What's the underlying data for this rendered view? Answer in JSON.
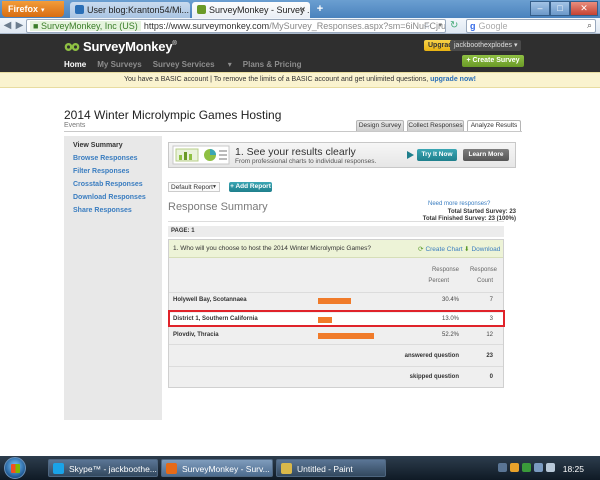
{
  "browser": {
    "menu_label": "Firefox",
    "tabs": [
      {
        "title": "User blog:Kranton54/Mi...",
        "active": false
      },
      {
        "title": "SurveyMonkey - Survey ...",
        "active": true
      }
    ],
    "identity": "SurveyMonkey, Inc (US)",
    "url_host": "https://www.surveymonkey.com",
    "url_rest": "/MySurvey_Responses.aspx?sm=6iNuFCjru",
    "search_engine": "Google",
    "search_placeholder": "Google"
  },
  "sm_header": {
    "logo_text": "SurveyMonkey",
    "upgrade_label": "Upgrade",
    "username": "jackboothexplodes",
    "nav": [
      "Home",
      "My Surveys",
      "Survey Services",
      "Plans & Pricing"
    ],
    "nav_active": "Home",
    "nav_dropdown": "Survey Services",
    "create_survey_label": "+ Create Survey"
  },
  "basic_banner": {
    "text": "You have a BASIC account   |   To remove the limits of a BASIC account and get unlimited questions,",
    "link": "upgrade now!"
  },
  "page": {
    "title": "2014 Winter Microlympic Games Hosting",
    "subtitle": "Events",
    "tabs": [
      "Design Survey",
      "Collect Responses",
      "Analyze Results"
    ],
    "active_tab": "Analyze Results"
  },
  "sidebar": {
    "items": [
      "View Summary",
      "Browse Responses",
      "Filter Responses",
      "Crosstab Responses",
      "Download Responses",
      "Share Responses"
    ],
    "current": "View Summary"
  },
  "promo": {
    "title": "1. See your results clearly",
    "subtitle": "From professional charts to individual responses.",
    "try_label": "Try It Now",
    "learn_label": "Learn More"
  },
  "report": {
    "selected": "Default Report",
    "add_label": "+ Add Report"
  },
  "summary": {
    "title": "Response Summary",
    "need_more": "Need more responses?",
    "total_started": "Total Started Survey: 23",
    "total_finished": "Total Finished Survey: 23  (100%)",
    "page_label": "PAGE: 1"
  },
  "question": {
    "text": "1. Who will you choose to host the 2014 Winter Microlympic Games?",
    "create_chart": "Create Chart",
    "download": "Download",
    "col_percent_1": "Response",
    "col_percent_2": "Percent",
    "col_count_1": "Response",
    "col_count_2": "Count",
    "rows": [
      {
        "label": "Holywell Bay, Scotannaea",
        "percent_text": "30.4%",
        "percent": 30.4,
        "count": "7"
      },
      {
        "label": "District 1, Southern California",
        "percent_text": "13.0%",
        "percent": 13.0,
        "count": "3"
      },
      {
        "label": "Plovdiv, Thracia",
        "percent_text": "52.2%",
        "percent": 52.2,
        "count": "12"
      }
    ],
    "highlighted_row": "District 1, Southern California",
    "answered_label": "answered question",
    "answered": "23",
    "skipped_label": "skipped question",
    "skipped": "0"
  },
  "taskbar": {
    "tasks": [
      {
        "title": "Skype™ - jackboothe...",
        "active": false
      },
      {
        "title": "SurveyMonkey - Surv...",
        "active": true
      },
      {
        "title": "Untitled - Paint",
        "active": false
      }
    ],
    "clock": "18:25"
  },
  "colors": {
    "sm_green": "#6a9a27",
    "bar_orange": "#f07b2a",
    "highlight_red": "#e0232a",
    "link_blue": "#3a7dc0"
  }
}
